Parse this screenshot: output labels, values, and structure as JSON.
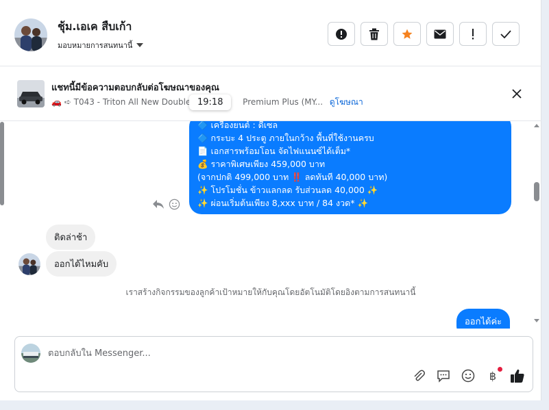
{
  "header": {
    "contact_name": "ชุ้ม.เอเค สืบเก้า",
    "assign_label": "มอบหมายการสนทนานี้",
    "actions": [
      "report-icon",
      "trash-icon",
      "star-icon",
      "mail-icon",
      "flag-icon",
      "check-icon"
    ]
  },
  "ad": {
    "title": "แชทนี้มีข้อความตอบกลับต่อโฆษณาของคุณ",
    "subtitle": "🚗 ➪ T043 - Triton All New Double C",
    "subtitle_tail": "Premium Plus (MY...",
    "link_label": "ดูโฆษณา",
    "tooltip": "19:18"
  },
  "messages": {
    "outgoing_lines": [
      "🔷 เครื่องยนต์ : ดีเซล",
      "🔷 กระบะ 4 ประตู ภายในกว้าง พื้นที่ใช้งานครบ",
      "📄 เอกสารพร้อมโอน จัดไฟแนนซ์ได้เต็ม*",
      "💰 ราคาพิเศษเพียง 459,000 บาท",
      "(จากปกติ 499,000 บาท ‼️ ลดทันที 40,000 บาท)",
      "✨ โปรโมชั่น ข้าวแลกลด รับส่วนลด 40,000 ✨",
      "✨ ผ่อนเริ่มต้นเพียง 8,xxx บาท / 84 งวด* ✨"
    ],
    "incoming_1": "ติดล่าช้า",
    "incoming_2": "ออกได้ไหมคับ",
    "system_note": "เราสร้างกิจกรรมของลูกค้าเป้าหมายให้กับคุณโดยอัตโนมัติโดยอิงตามการสนทนานี้",
    "outgoing_2": "ออกได้ค่ะ"
  },
  "composer": {
    "placeholder": "ตอบกลับใน Messenger...",
    "currency_symbol": "฿"
  },
  "colors": {
    "brand_blue": "#0a7cff",
    "star_orange": "#f5821f",
    "notification_red": "#e41e3f"
  }
}
